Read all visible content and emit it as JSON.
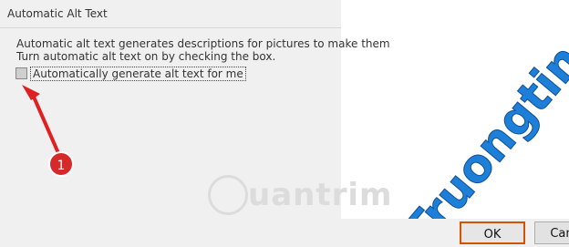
{
  "dialog": {
    "title": "Automatic Alt Text",
    "description_line1": "Automatic alt text generates descriptions for pictures to make them",
    "description_line2": "Turn automatic alt text on by checking the box.",
    "checkbox": {
      "label": "Automatically generate alt text for me",
      "checked": false
    },
    "annotation_number": "1"
  },
  "buttons": {
    "ok": "OK",
    "cancel": "Can"
  },
  "watermark": {
    "text": "uantrim"
  },
  "brand": {
    "text": "Truongtin.top",
    "color": "#1e7fd9"
  }
}
